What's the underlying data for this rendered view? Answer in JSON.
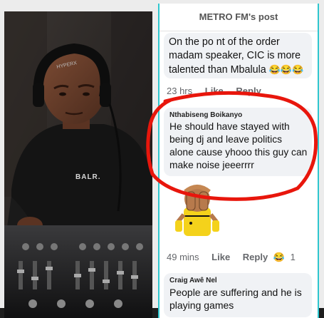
{
  "post": {
    "title": "METRO FM's post"
  },
  "comments": [
    {
      "name": "",
      "text": "On the po nt of the order madam speaker, CIC is more talented than Mbalula",
      "emojis": "😂😂😂",
      "time": "23 hrs",
      "like": "Like",
      "reply": "Reply"
    },
    {
      "name": "Nthabiseng Boikanyo",
      "text": "He should have stayed with being dj and leave politics alone cause yhooo this guy can make noise jeeerrrr",
      "time": "49 mins",
      "like": "Like",
      "reply": "Reply",
      "reaction_emoji": "😂",
      "reaction_count": "1"
    },
    {
      "name": "Craig Awê Nel",
      "text": "People are suffering and he is playing games"
    }
  ],
  "photo": {
    "headphone_brand": "HYPERX",
    "shirt_logo": "BALR."
  },
  "colors": {
    "panel_border": "#2ec6cf",
    "annotation_circle": "#e8160c",
    "bubble_bg": "#f0f2f5",
    "meta_text": "#65676b"
  }
}
